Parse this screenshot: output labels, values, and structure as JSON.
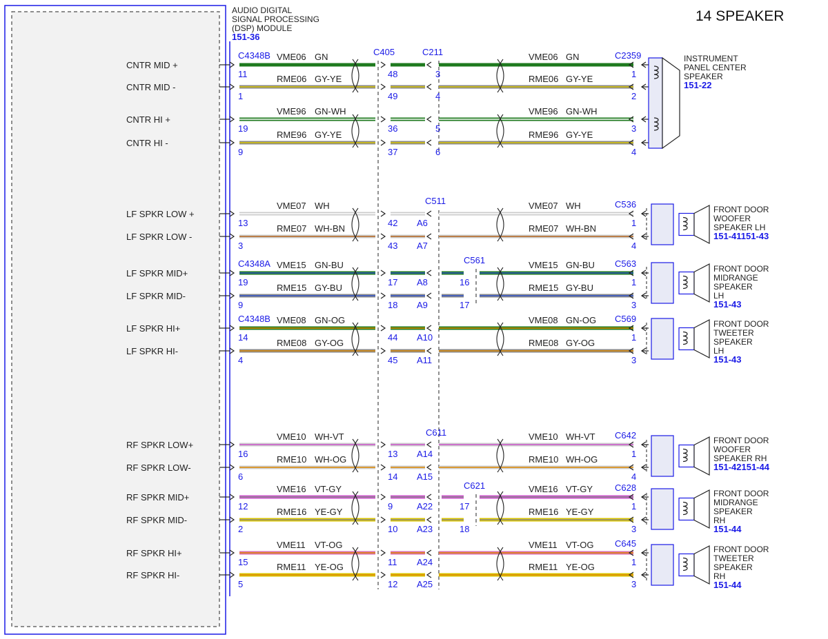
{
  "page_title": "14 SPEAKER",
  "module": {
    "name_lines": [
      "AUDIO DIGITAL",
      "SIGNAL PROCESSING",
      "(DSP) MODULE"
    ],
    "ref": "151-36"
  },
  "connectors": {
    "c405": "C405",
    "c211": "C211",
    "c511": "C511",
    "c561": "C561",
    "c611": "C611",
    "c621": "C621"
  },
  "circuits": [
    {
      "label": "CNTR MID +",
      "start": "C4348B",
      "pin": "11",
      "wire": "VME06",
      "color": "GN",
      "m1": "48",
      "m2": "3",
      "m3": "",
      "end_conn": "C2359",
      "end_pin": "1",
      "c1": "#1f7a1f",
      "c2": "#1f7a1f"
    },
    {
      "label": "CNTR MID -",
      "start": "",
      "pin": "1",
      "wire": "RME06",
      "color": "GY-YE",
      "m1": "49",
      "m2": "4",
      "m3": "",
      "end_conn": "",
      "end_pin": "2",
      "c1": "#8a8a8a",
      "c2": "#d9c400"
    },
    {
      "label": "CNTR HI +",
      "start": "",
      "pin": "19",
      "wire": "VME96",
      "color": "GN-WH",
      "m1": "36",
      "m2": "5",
      "m3": "",
      "end_conn": "",
      "end_pin": "3",
      "c1": "#1f7a1f",
      "c2": "#ffffff"
    },
    {
      "label": "CNTR HI -",
      "start": "",
      "pin": "9",
      "wire": "RME96",
      "color": "GY-YE",
      "m1": "37",
      "m2": "6",
      "m3": "",
      "end_conn": "",
      "end_pin": "4",
      "c1": "#8a8a8a",
      "c2": "#d9c400"
    },
    {
      "label": "LF SPKR LOW +",
      "start": "",
      "pin": "13",
      "wire": "VME07",
      "color": "WH",
      "m1": "42",
      "m2": "A6",
      "m3": "",
      "end_conn": "C536",
      "end_pin": "1",
      "c1": "#cccccc",
      "c2": "#ffffff"
    },
    {
      "label": "LF SPKR LOW -",
      "start": "",
      "pin": "3",
      "wire": "RME07",
      "color": "WH-BN",
      "m1": "43",
      "m2": "A7",
      "m3": "",
      "end_conn": "",
      "end_pin": "4",
      "c1": "#cccccc",
      "c2": "#b5651d"
    },
    {
      "label": "LF SPKR MID+",
      "start": "C4348A",
      "pin": "19",
      "wire": "VME15",
      "color": "GN-BU",
      "m1": "17",
      "m2": "A8",
      "m3": "16",
      "end_conn": "C563",
      "end_pin": "1",
      "c1": "#1f7a1f",
      "c2": "#3355cc"
    },
    {
      "label": "LF SPKR MID-",
      "start": "",
      "pin": "9",
      "wire": "RME15",
      "color": "GY-BU",
      "m1": "18",
      "m2": "A9",
      "m3": "17",
      "end_conn": "",
      "end_pin": "3",
      "c1": "#8a8a8a",
      "c2": "#3355cc"
    },
    {
      "label": "LF SPKR HI+",
      "start": "C4348B",
      "pin": "14",
      "wire": "VME08",
      "color": "GN-OG",
      "m1": "44",
      "m2": "A10",
      "m3": "",
      "end_conn": "C569",
      "end_pin": "1",
      "c1": "#1f7a1f",
      "c2": "#e08a00"
    },
    {
      "label": "LF SPKR HI-",
      "start": "",
      "pin": "4",
      "wire": "RME08",
      "color": "GY-OG",
      "m1": "45",
      "m2": "A11",
      "m3": "",
      "end_conn": "",
      "end_pin": "3",
      "c1": "#8a8a8a",
      "c2": "#e08a00"
    },
    {
      "label": "RF SPKR LOW+",
      "start": "",
      "pin": "16",
      "wire": "VME10",
      "color": "WH-VT",
      "m1": "13",
      "m2": "A14",
      "m3": "",
      "end_conn": "C642",
      "end_pin": "1",
      "c1": "#cccccc",
      "c2": "#cc55cc"
    },
    {
      "label": "RF SPKR LOW-",
      "start": "",
      "pin": "6",
      "wire": "RME10",
      "color": "WH-OG",
      "m1": "14",
      "m2": "A15",
      "m3": "",
      "end_conn": "",
      "end_pin": "4",
      "c1": "#cccccc",
      "c2": "#e08a00"
    },
    {
      "label": "RF SPKR MID+",
      "start": "",
      "pin": "12",
      "wire": "VME16",
      "color": "VT-GY",
      "m1": "9",
      "m2": "A22",
      "m3": "17",
      "end_conn": "C628",
      "end_pin": "1",
      "c1": "#cc55cc",
      "c2": "#8a8a8a"
    },
    {
      "label": "RF SPKR MID-",
      "start": "",
      "pin": "2",
      "wire": "RME16",
      "color": "YE-GY",
      "m1": "10",
      "m2": "A23",
      "m3": "18",
      "end_conn": "",
      "end_pin": "3",
      "c1": "#d9c400",
      "c2": "#8a8a8a"
    },
    {
      "label": "RF SPKR HI+",
      "start": "",
      "pin": "15",
      "wire": "VME11",
      "color": "VT-OG",
      "m1": "11",
      "m2": "A24",
      "m3": "",
      "end_conn": "C645",
      "end_pin": "1",
      "c1": "#d86fb0",
      "c2": "#e08a00"
    },
    {
      "label": "RF SPKR HI-",
      "start": "",
      "pin": "5",
      "wire": "RME11",
      "color": "YE-OG",
      "m1": "12",
      "m2": "A25",
      "m3": "",
      "end_conn": "",
      "end_pin": "3",
      "c1": "#d9c400",
      "c2": "#e08a00"
    }
  ],
  "speakers": [
    {
      "lines": [
        "INSTRUMENT",
        "PANEL CENTER",
        "SPEAKER"
      ],
      "ref": "151-22"
    },
    {
      "lines": [
        "FRONT DOOR",
        "WOOFER",
        "SPEAKER LH"
      ],
      "ref": "151-41151-43"
    },
    {
      "lines": [
        "FRONT DOOR",
        "MIDRANGE",
        "SPEAKER",
        "LH"
      ],
      "ref": "151-43"
    },
    {
      "lines": [
        "FRONT DOOR",
        "TWEETER",
        "SPEAKER",
        "LH"
      ],
      "ref": "151-43"
    },
    {
      "lines": [
        "FRONT DOOR",
        "WOOFER",
        "SPEAKER RH"
      ],
      "ref": "151-42151-44"
    },
    {
      "lines": [
        "FRONT DOOR",
        "MIDRANGE",
        "SPEAKER",
        "RH"
      ],
      "ref": "151-44"
    },
    {
      "lines": [
        "FRONT DOOR",
        "TWEETER",
        "SPEAKER",
        "RH"
      ],
      "ref": "151-44"
    }
  ]
}
